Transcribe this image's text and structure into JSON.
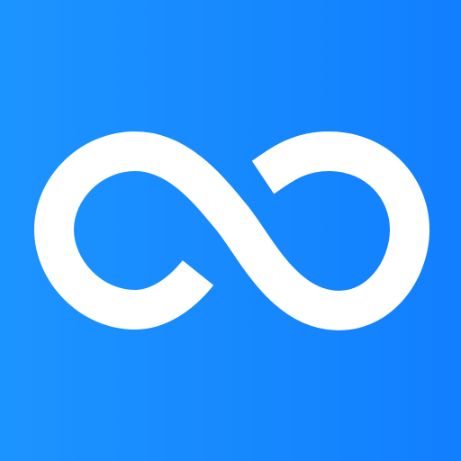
{
  "app_icon": {
    "icon": "infinity-icon",
    "colors": {
      "gradient_start": "#1c94ff",
      "gradient_end": "#127ffe",
      "symbol": "#ffffff"
    }
  }
}
